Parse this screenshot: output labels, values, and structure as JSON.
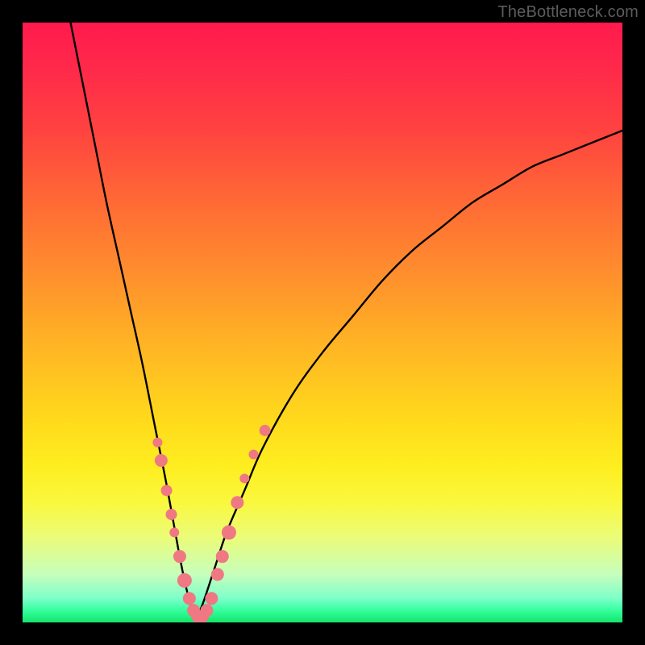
{
  "watermark": "TheBottleneck.com",
  "colors": {
    "frame": "#000000",
    "curve_stroke": "#000000",
    "marker_fill": "#ef7882",
    "gradient_stops": [
      {
        "pct": 0,
        "hex": "#ff1a4d"
      },
      {
        "pct": 8,
        "hex": "#ff2a4a"
      },
      {
        "pct": 18,
        "hex": "#ff4340"
      },
      {
        "pct": 30,
        "hex": "#ff6a35"
      },
      {
        "pct": 42,
        "hex": "#ff8f2d"
      },
      {
        "pct": 54,
        "hex": "#ffb524"
      },
      {
        "pct": 66,
        "hex": "#ffd91c"
      },
      {
        "pct": 74,
        "hex": "#feee20"
      },
      {
        "pct": 80,
        "hex": "#faf83e"
      },
      {
        "pct": 86,
        "hex": "#eafc7a"
      },
      {
        "pct": 92,
        "hex": "#c6febc"
      },
      {
        "pct": 96,
        "hex": "#7dffc9"
      },
      {
        "pct": 98,
        "hex": "#34ff9f"
      },
      {
        "pct": 100,
        "hex": "#14e569"
      }
    ]
  },
  "chart_data": {
    "type": "line",
    "title": "",
    "xlabel": "",
    "ylabel": "",
    "xlim": [
      0,
      100
    ],
    "ylim": [
      0,
      100
    ],
    "note": "x is horizontal position (0=left,100=right); y is bottleneck magnitude (0=bottom/green, 100=top/red). V-shaped curve with minimum near x≈29.",
    "series": [
      {
        "name": "curve-left",
        "x": [
          8,
          10,
          12,
          14,
          16,
          18,
          20,
          22,
          24,
          26,
          27,
          28,
          29
        ],
        "y": [
          100,
          90,
          80,
          70,
          61,
          52,
          43,
          33,
          23,
          12,
          7,
          3,
          1
        ]
      },
      {
        "name": "curve-right",
        "x": [
          29,
          30,
          32,
          34,
          37,
          40,
          45,
          50,
          55,
          60,
          65,
          70,
          75,
          80,
          85,
          90,
          95,
          100
        ],
        "y": [
          1,
          3,
          9,
          15,
          22,
          29,
          38,
          45,
          51,
          57,
          62,
          66,
          70,
          73,
          76,
          78,
          80,
          82
        ]
      }
    ],
    "markers": {
      "name": "sample-points",
      "fill": "#ef7882",
      "points": [
        {
          "x": 22.5,
          "y": 30,
          "r": 6
        },
        {
          "x": 23.1,
          "y": 27,
          "r": 8
        },
        {
          "x": 24.0,
          "y": 22,
          "r": 7
        },
        {
          "x": 24.8,
          "y": 18,
          "r": 7
        },
        {
          "x": 25.3,
          "y": 15,
          "r": 6
        },
        {
          "x": 26.2,
          "y": 11,
          "r": 8
        },
        {
          "x": 27.0,
          "y": 7,
          "r": 9
        },
        {
          "x": 27.8,
          "y": 4,
          "r": 8
        },
        {
          "x": 28.5,
          "y": 2,
          "r": 8
        },
        {
          "x": 29.2,
          "y": 1,
          "r": 8
        },
        {
          "x": 30.0,
          "y": 1,
          "r": 8
        },
        {
          "x": 30.7,
          "y": 2,
          "r": 8
        },
        {
          "x": 31.5,
          "y": 4,
          "r": 8
        },
        {
          "x": 32.5,
          "y": 8,
          "r": 8
        },
        {
          "x": 33.3,
          "y": 11,
          "r": 8
        },
        {
          "x": 34.4,
          "y": 15,
          "r": 9
        },
        {
          "x": 35.8,
          "y": 20,
          "r": 8
        },
        {
          "x": 37.0,
          "y": 24,
          "r": 6
        },
        {
          "x": 38.5,
          "y": 28,
          "r": 6
        },
        {
          "x": 40.4,
          "y": 32,
          "r": 7
        }
      ]
    }
  }
}
